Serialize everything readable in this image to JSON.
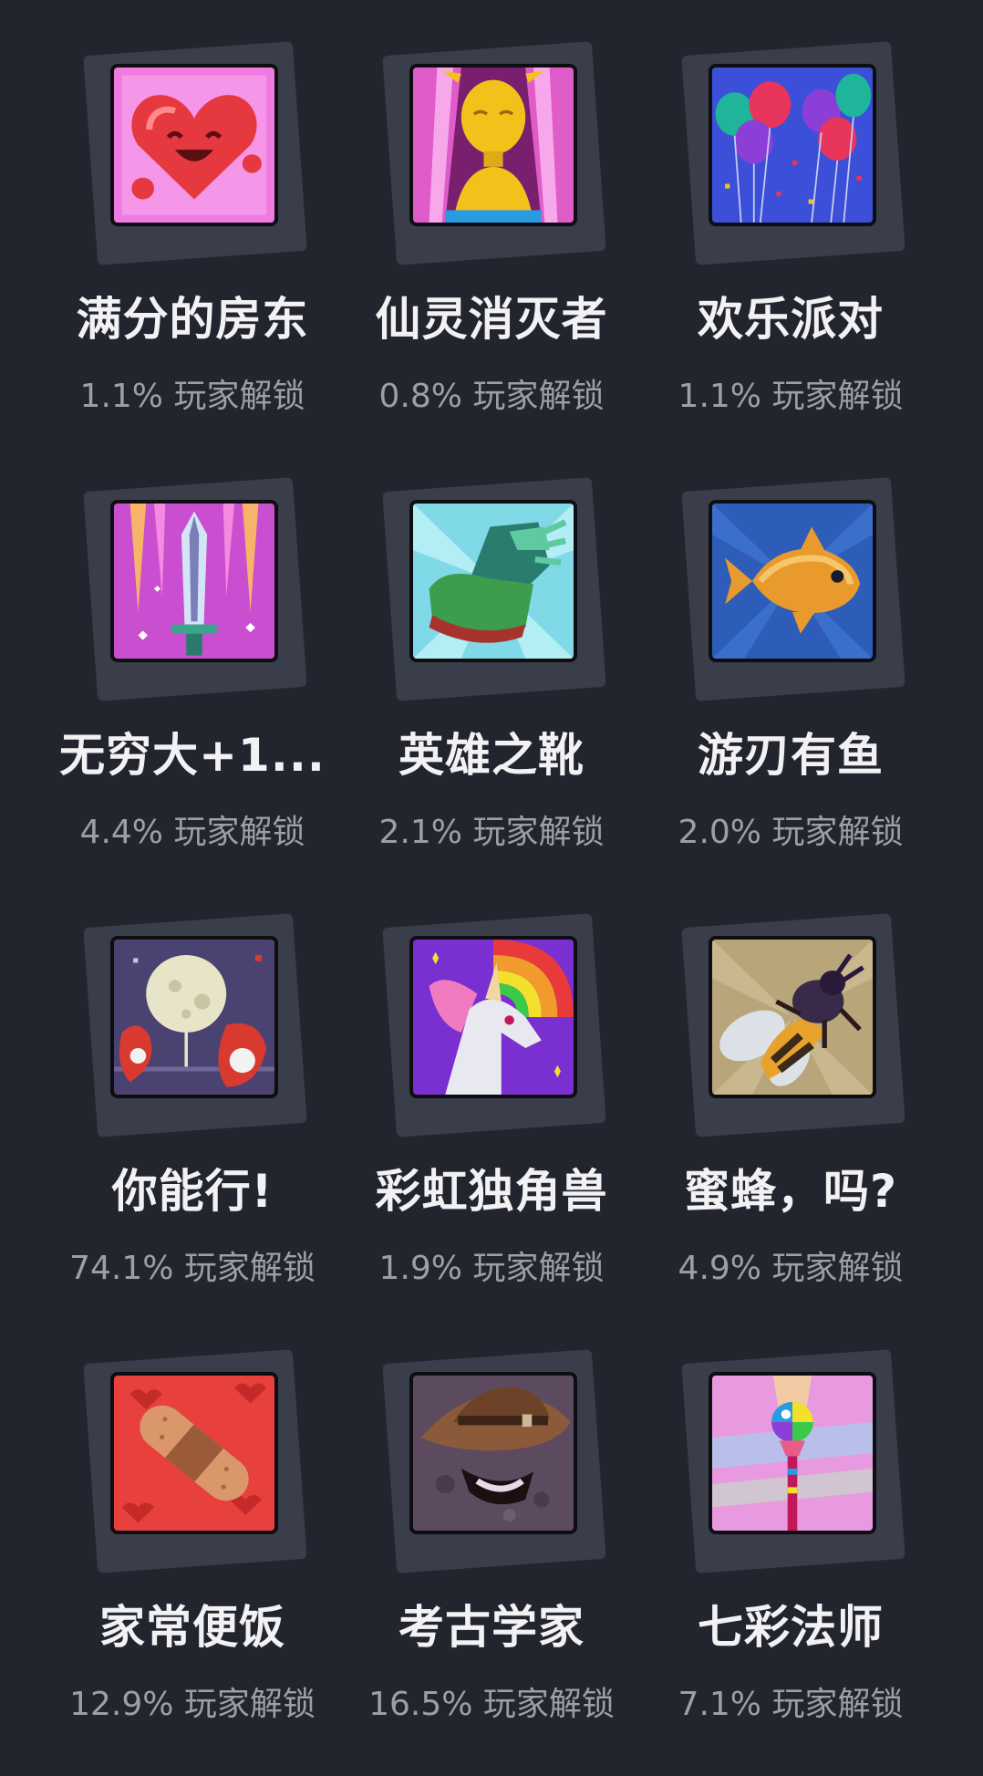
{
  "achievements": [
    {
      "title": "满分的房东",
      "rate": "1.1% 玩家解锁",
      "icon": "smiling-heart-icon"
    },
    {
      "title": "仙灵消灭者",
      "rate": "0.8% 玩家解锁",
      "icon": "fairy-icon"
    },
    {
      "title": "欢乐派对",
      "rate": "1.1% 玩家解锁",
      "icon": "balloons-icon"
    },
    {
      "title": "无穷大+1...",
      "rate": "4.4% 玩家解锁",
      "icon": "sword-icon"
    },
    {
      "title": "英雄之靴",
      "rate": "2.1% 玩家解锁",
      "icon": "boot-icon"
    },
    {
      "title": "游刃有鱼",
      "rate": "2.0% 玩家解锁",
      "icon": "goldfish-icon"
    },
    {
      "title": "你能行!",
      "rate": "74.1% 玩家解锁",
      "icon": "moon-crab-icon"
    },
    {
      "title": "彩虹独角兽",
      "rate": "1.9% 玩家解锁",
      "icon": "unicorn-icon"
    },
    {
      "title": "蜜蜂，吗?",
      "rate": "4.9% 玩家解锁",
      "icon": "bee-icon"
    },
    {
      "title": "家常便饭",
      "rate": "12.9% 玩家解锁",
      "icon": "bandage-icon"
    },
    {
      "title": "考古学家",
      "rate": "16.5% 玩家解锁",
      "icon": "archaeologist-hat-icon"
    },
    {
      "title": "七彩法师",
      "rate": "7.1% 玩家解锁",
      "icon": "rainbow-staff-icon"
    }
  ]
}
